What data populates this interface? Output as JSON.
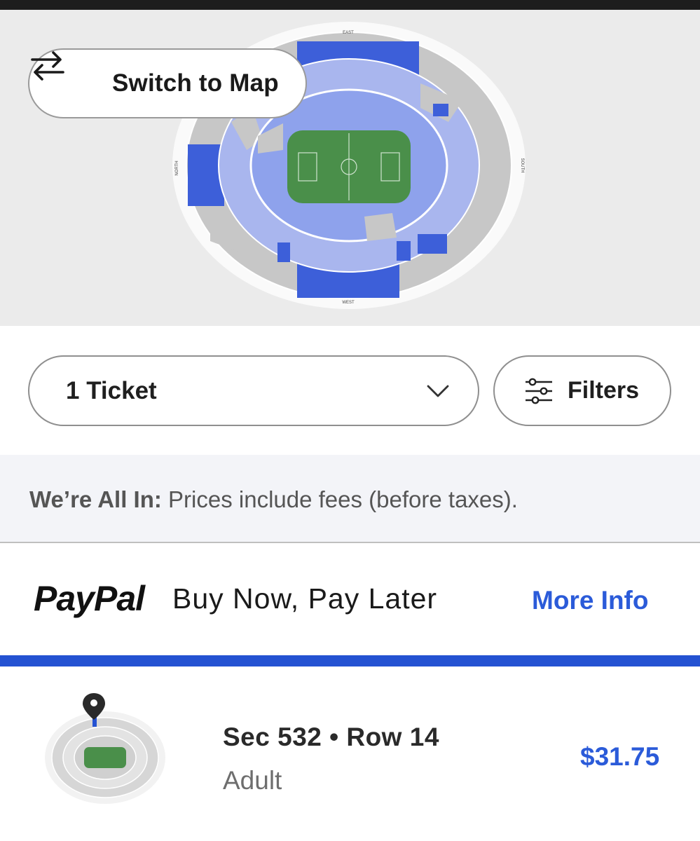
{
  "map": {
    "switch_label": "Switch to Map",
    "icon": "swap-arrows-icon",
    "compass": {
      "north": "NORTH",
      "south": "SOUTH",
      "east": "EAST",
      "west": "WEST"
    },
    "colors": {
      "available_dark": "#3d5fd9",
      "available_light": "#9aabee",
      "unavailable": "#c5c5c5",
      "field": "#4a8f4a",
      "background": "#ebebeb"
    }
  },
  "controls": {
    "ticket_quantity": "1 Ticket",
    "quantity_icon": "chevron-down-icon",
    "filters_label": "Filters",
    "filters_icon": "sliders-icon"
  },
  "notice": {
    "bold": "We’re All In:",
    "text": " Prices include fees (before taxes)."
  },
  "paypal": {
    "logo": "PayPal",
    "text": "Buy Now, Pay Later",
    "link": "More Info"
  },
  "listing": {
    "section_row": "Sec 532 • Row 14",
    "ticket_type": "Adult",
    "price": "$31.75",
    "thumbnail_icon": "location-pin-icon"
  },
  "colors": {
    "accent": "#2b5bd9",
    "bar": "#2452d2"
  }
}
